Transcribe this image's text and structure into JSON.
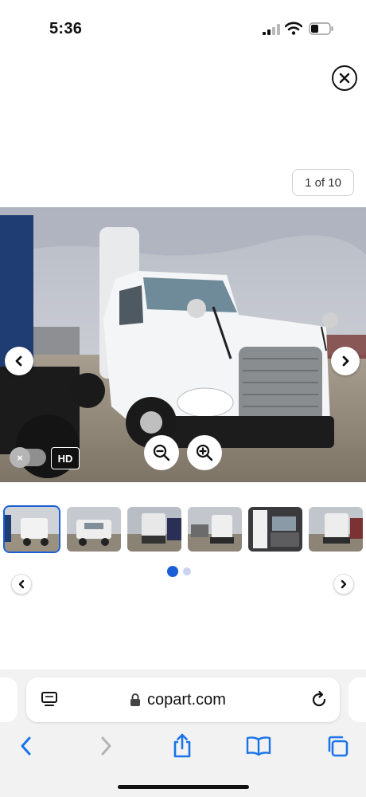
{
  "status_bar": {
    "time": "5:36"
  },
  "viewer": {
    "counter": "1 of 10",
    "hd_label": "HD",
    "hd_toggle_symbol": "×",
    "icons": {
      "close": "close-icon",
      "prev": "chevron-left-icon",
      "next": "chevron-right-icon",
      "zoom_out": "zoom-out-icon",
      "zoom_in": "zoom-in-icon"
    }
  },
  "thumbnails": {
    "count_visible": 6,
    "active_index": 0,
    "pages": 2,
    "current_page": 1,
    "accent_color": "#1a5fd6"
  },
  "browser": {
    "url": "copart.com",
    "toolbar_icons": [
      "back-icon",
      "forward-icon",
      "share-icon",
      "bookmarks-icon",
      "tabs-icon"
    ],
    "accent_color": "#1a73e8"
  }
}
